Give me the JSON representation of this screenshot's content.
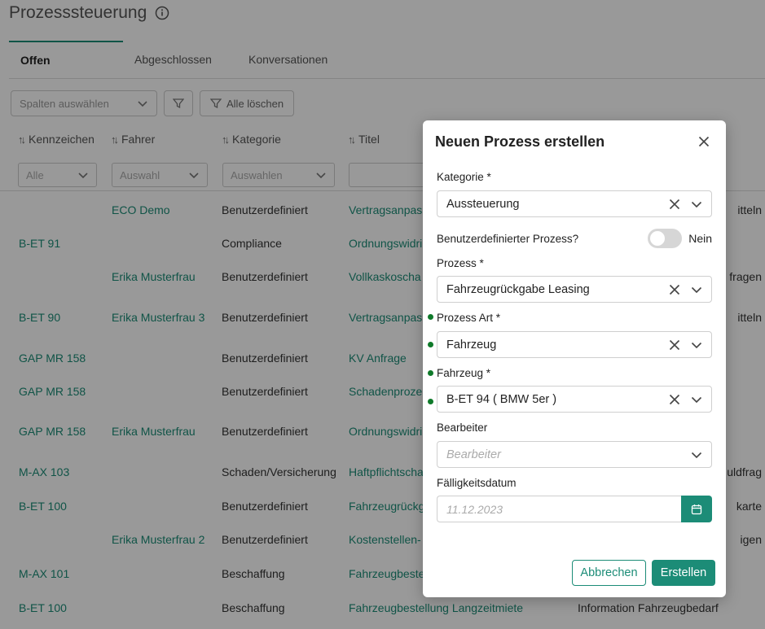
{
  "page": {
    "title": "Prozesssteuerung",
    "tabs": [
      "Offen",
      "Abgeschlossen",
      "Konversationen"
    ],
    "toolbar": {
      "select_placeholder": "Spalten auswählen",
      "clear_filter_label": "Alle löschen"
    },
    "columns": [
      "Kennzeichen",
      "Fahrer",
      "Kategorie",
      "Titel"
    ],
    "filters": [
      "Alle",
      "Auswahl",
      "Auswahlen",
      ""
    ],
    "rows": [
      {
        "kennzeichen": "",
        "fahrer": "ECO Demo",
        "kategorie": "Benutzerdefiniert",
        "titel": "Vertragsanpas",
        "extra": "itteln"
      },
      {
        "kennzeichen": "B-ET 91",
        "fahrer": "",
        "kategorie": "Compliance",
        "titel": "Ordnungswidri",
        "extra": ""
      },
      {
        "kennzeichen": "",
        "fahrer": "Erika Musterfrau",
        "kategorie": "Benutzerdefiniert",
        "titel": "Vollkaskoscha",
        "extra": "fragen"
      },
      {
        "kennzeichen": "B-ET 90",
        "fahrer": "Erika Musterfrau 3",
        "kategorie": "Benutzerdefiniert",
        "titel": "Vertragsanpas",
        "extra": "itteln"
      },
      {
        "kennzeichen": "GAP MR 158",
        "fahrer": "",
        "kategorie": "Benutzerdefiniert",
        "titel": "KV Anfrage",
        "extra": ""
      },
      {
        "kennzeichen": "GAP MR 158",
        "fahrer": "",
        "kategorie": "Benutzerdefiniert",
        "titel": "Schadenproze",
        "extra": ""
      },
      {
        "kennzeichen": "GAP MR 158",
        "fahrer": "Erika Musterfrau",
        "kategorie": "Benutzerdefiniert",
        "titel": "Ordnungswidri",
        "extra": ""
      },
      {
        "kennzeichen": "M-AX 103",
        "fahrer": "",
        "kategorie": "Schaden/Versicherung",
        "titel": "Haftpflichtscha",
        "extra": "uldfrag"
      },
      {
        "kennzeichen": "B-ET 100",
        "fahrer": "",
        "kategorie": "Benutzerdefiniert",
        "titel": "Fahrzeugrückg",
        "extra": "karte"
      },
      {
        "kennzeichen": "",
        "fahrer": "Erika Musterfrau 2",
        "kategorie": "Benutzerdefiniert",
        "titel": "Kostenstellen-",
        "extra": "igen"
      },
      {
        "kennzeichen": "M-AX 101",
        "fahrer": "",
        "kategorie": "Beschaffung",
        "titel": "Fahrzeugbeste",
        "extra": ""
      },
      {
        "kennzeichen": "B-ET 100",
        "fahrer": "",
        "kategorie": "Beschaffung",
        "titel": "Fahrzeugbestellung Langzeitmiete",
        "extra": "Information Fahrzeugbedarf"
      }
    ]
  },
  "modal": {
    "title": "Neuen Prozess erstellen",
    "kategorie": {
      "label": "Kategorie *",
      "value": "Aussteuerung"
    },
    "custom_process": {
      "label": "Benutzerdefinierter Prozess?",
      "state": "Nein"
    },
    "prozess": {
      "label": "Prozess *",
      "value": "Fahrzeugrückgabe Leasing"
    },
    "prozess_art": {
      "label": "Prozess Art *",
      "value": "Fahrzeug"
    },
    "fahrzeug": {
      "label": "Fahrzeug *",
      "value": "B-ET 94 ( BMW 5er )"
    },
    "bearbeiter": {
      "label": "Bearbeiter",
      "placeholder": "Bearbeiter"
    },
    "faelligkeit": {
      "label": "Fälligkeitsdatum",
      "placeholder": "11.12.2023"
    },
    "buttons": {
      "cancel": "Abbrechen",
      "create": "Erstellen"
    }
  },
  "colors": {
    "accent": "#1c8c77",
    "indicator": "#0f7a2a"
  }
}
